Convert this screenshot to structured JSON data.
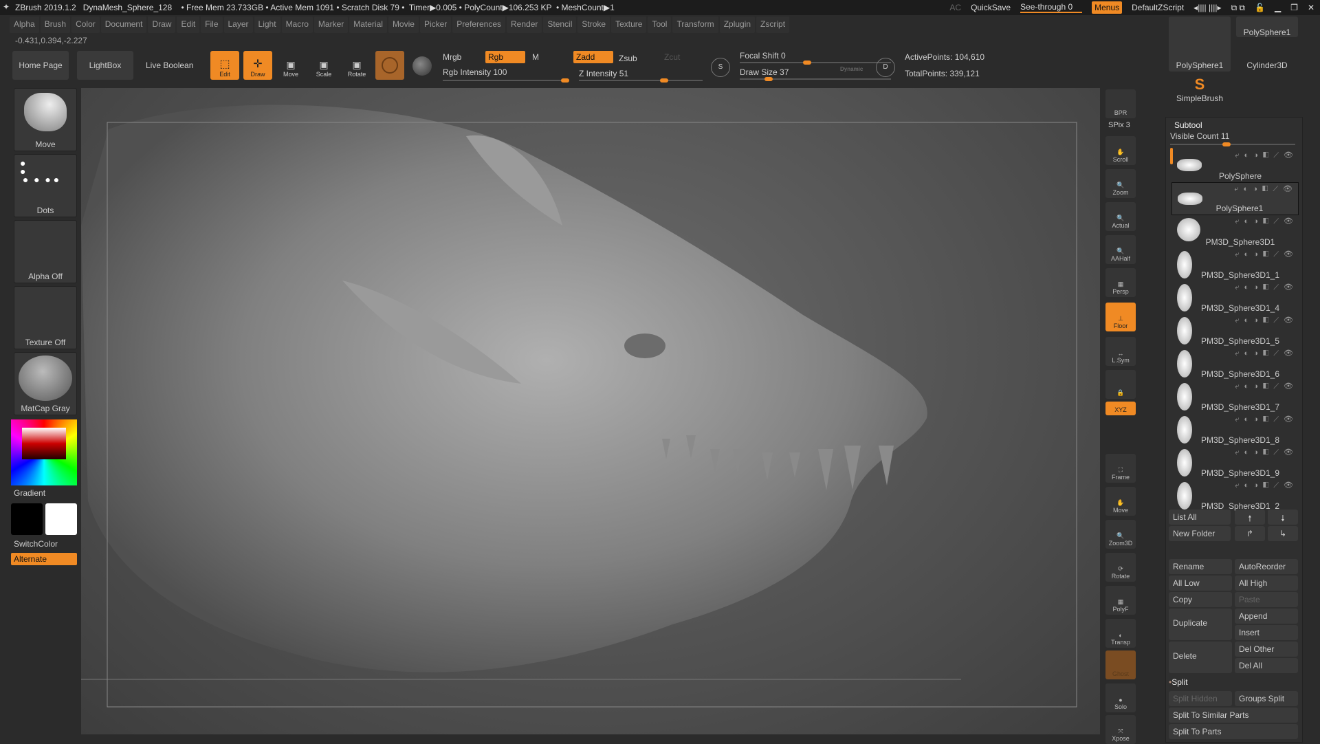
{
  "titlebar": {
    "title": "ZBrush 2019.1.2   DynaMesh_Sphere_128    • Free Mem 23.733GB • Active Mem 1091 • Scratch Disk 79 •  Timer▶0.005 • PolyCount▶106.253 KP  • MeshCount▶1",
    "ac": "AC",
    "quicksave": "QuickSave",
    "see_through": "See-through  0",
    "see_through_value": 0,
    "menus": "Menus",
    "script": "DefaultZScript"
  },
  "menu": [
    "Alpha",
    "Brush",
    "Color",
    "Document",
    "Draw",
    "Edit",
    "File",
    "Layer",
    "Light",
    "Macro",
    "Marker",
    "Material",
    "Movie",
    "Picker",
    "Preferences",
    "Render",
    "Stencil",
    "Stroke",
    "Texture",
    "Tool",
    "Transform",
    "Zplugin",
    "Zscript"
  ],
  "coords": "-0.431,0.394,-2.227",
  "shelf": {
    "home": "Home Page",
    "lightbox": "LightBox",
    "live_boolean": "Live Boolean",
    "edit": "Edit",
    "draw": "Draw",
    "move": "Move",
    "scale": "Scale",
    "rotate": "Rotate",
    "mrgb": "Mrgb",
    "rgb": "Rgb",
    "m": "M",
    "zadd": "Zadd",
    "zsub": "Zsub",
    "zcut": "Zcut",
    "rgb_intensity": "Rgb Intensity 100",
    "rgb_intensity_value": 100,
    "z_intensity": "Z Intensity 51",
    "z_intensity_value": 51,
    "focal_shift": "Focal Shift 0",
    "focal_shift_value": 0,
    "draw_size": "Draw Size 37",
    "draw_size_value": 37,
    "dynamic": "Dynamic",
    "active_points": "ActivePoints: 104,610",
    "total_points": "TotalPoints: 339,121"
  },
  "left": {
    "brush": "Move",
    "stroke": "Dots",
    "alpha": "Alpha Off",
    "texture": "Texture Off",
    "material": "MatCap Gray",
    "gradient": "Gradient",
    "switch": "SwitchColor",
    "alternate": "Alternate"
  },
  "right_tools": [
    "BPR",
    "Scroll",
    "Zoom",
    "Actual",
    "AAHalf",
    "Persp",
    "Floor",
    "L.Sym",
    "",
    "XYZ",
    "Frame",
    "Move",
    "Zoom3D",
    "Rotate",
    "PolyF",
    "Transp",
    "Ghost",
    "Solo",
    "Xpose"
  ],
  "spix": "SPix 3",
  "tool_thumbs": [
    "PolySphere1",
    "PolySphere1",
    "Cylinder3D",
    "SimpleBrush"
  ],
  "subtool": {
    "title": "Subtool",
    "visible_count": "Visible Count 11",
    "items": [
      "PolySphere",
      "PolySphere1",
      "PM3D_Sphere3D1",
      "PM3D_Sphere3D1_1",
      "PM3D_Sphere3D1_4",
      "PM3D_Sphere3D1_5",
      "PM3D_Sphere3D1_6",
      "PM3D_Sphere3D1_7",
      "PM3D_Sphere3D1_8",
      "PM3D_Sphere3D1_9",
      "PM3D_Sphere3D1_2"
    ],
    "list_all": "List All",
    "new_folder": "New Folder",
    "rename": "Rename",
    "autoreorder": "AutoReorder",
    "all_low": "All Low",
    "all_high": "All High",
    "copy": "Copy",
    "paste": "Paste",
    "duplicate": "Duplicate",
    "append": "Append",
    "insert": "Insert",
    "delete": "Delete",
    "del_other": "Del Other",
    "del_all": "Del All",
    "split": "Split",
    "split_hidden": "Split Hidden",
    "groups_split": "Groups Split",
    "split_similar": "Split To Similar Parts",
    "split_parts": "Split To Parts"
  },
  "accent": "#f08a24"
}
